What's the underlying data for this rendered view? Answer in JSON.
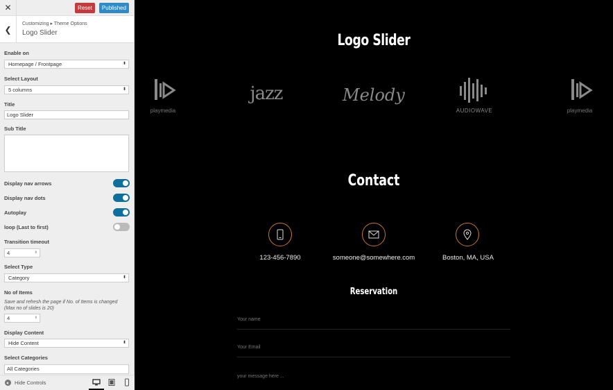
{
  "topbar": {
    "reset_label": "Reset",
    "publish_label": "Published"
  },
  "header": {
    "breadcrumb": "Customizing ▸ Theme Options",
    "title": "Logo Slider"
  },
  "controls": {
    "enable_on_label": "Enable on",
    "enable_on_value": "Homepage / Frontpage",
    "layout_label": "Select Layout",
    "layout_value": "5 columns",
    "title_label": "Title",
    "title_value": "Logo Slider",
    "subtitle_label": "Sub Title",
    "nav_arrows_label": "Display nav arrows",
    "nav_arrows_on": true,
    "nav_dots_label": "Display nav dots",
    "nav_dots_on": true,
    "autoplay_label": "Autoplay",
    "autoplay_on": true,
    "loop_label": "loop (Last to first)",
    "loop_on": false,
    "timeout_label": "Transition timeout",
    "timeout_value": "4",
    "type_label": "Select Type",
    "type_value": "Category",
    "items_label": "No of Items",
    "items_desc": "Save and refresh the page if No. of Items is changed (Max no of slides is 20)",
    "items_value": "4",
    "display_content_label": "Display Content",
    "display_content_value": "Hide Content",
    "categories_label": "Select Categories",
    "categories_value": "All Categories"
  },
  "footer": {
    "hide_controls_label": "Hide Controls"
  },
  "preview": {
    "logo_heading": "Logo Slider",
    "logos": [
      {
        "name": "playmedia",
        "text": "playmedia"
      },
      {
        "name": "jazz",
        "text": "jazz"
      },
      {
        "name": "melody",
        "text": "Melody"
      },
      {
        "name": "audiowave",
        "text": "AUDIOWAVE"
      },
      {
        "name": "playmedia",
        "text": "playmedia"
      }
    ],
    "contact_heading": "Contact",
    "phone": "123-456-7890",
    "email": "someone@somewhere.com",
    "address": "Boston, MA, USA",
    "reservation_heading": "Reservation",
    "name_placeholder": "Your name",
    "email_placeholder": "Your Email",
    "message_placeholder": "your message here ..."
  },
  "colors": {
    "reset": "#c33a3e",
    "publish": "#2e8bc7",
    "toggle_on": "#0e6f9c",
    "contact_ring": "#c9782c"
  }
}
